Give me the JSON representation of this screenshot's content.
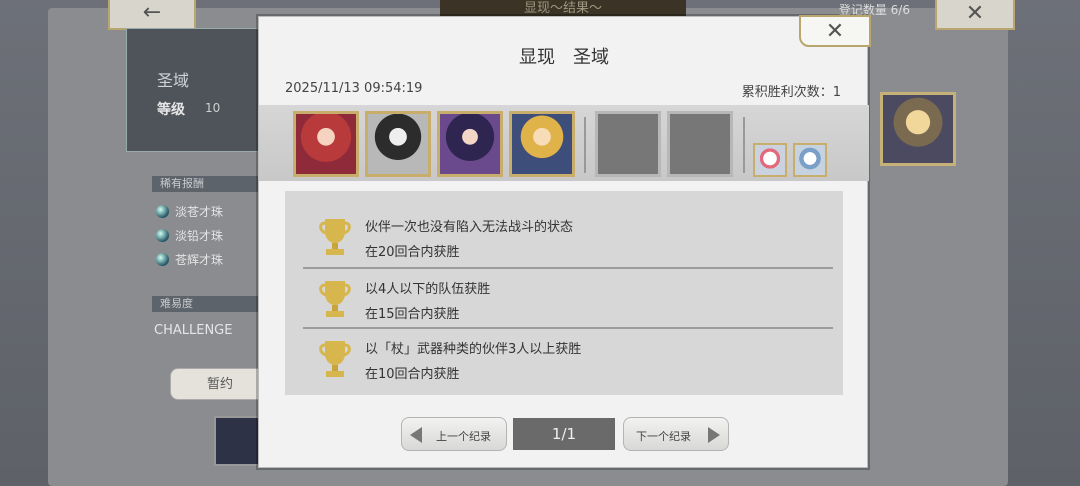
{
  "background": {
    "back_icon": "left-arrow-icon",
    "top_title": "显现～结果～",
    "record_count": "登记数量 6/6",
    "close_icon": "close-icon",
    "stage": {
      "name": "圣域",
      "level_label": "等级",
      "level_value": "10"
    },
    "rewards_label": "稀有报酬",
    "rewards": [
      "淡苍才珠",
      "淡铅才珠",
      "苍辉才珠"
    ],
    "difficulty_label": "难易度",
    "difficulty_value": "CHALLENGE",
    "pause_button": "暂约"
  },
  "modal": {
    "title": "显现　圣域",
    "close_icon": "close-icon",
    "date": "2025/11/13 09:54:19",
    "wins": "累积胜利次数：1",
    "party": {
      "characters": [
        "character-1",
        "character-2",
        "character-3",
        "character-4"
      ],
      "empty_slots": 2,
      "support": [
        "support-1",
        "support-2"
      ]
    },
    "records": [
      {
        "icon": "trophy-icon",
        "condition": "伙伴一次也没有陷入无法战斗的状态",
        "sub": "在20回合内获胜"
      },
      {
        "icon": "trophy-icon",
        "condition": "以4人以下的队伍获胜",
        "sub": "在15回合内获胜"
      },
      {
        "icon": "trophy-icon",
        "condition": "以「杖」武器种类的伙伴3人以上获胜",
        "sub": "在10回合内获胜"
      }
    ],
    "nav": {
      "prev": "上一个纪录",
      "next": "下一个纪录",
      "page": "1/1"
    }
  },
  "colors": {
    "frame_gold": "#c9ad6a",
    "trophy_gold": "#d4b24a",
    "panel": "#f2f2f2"
  }
}
